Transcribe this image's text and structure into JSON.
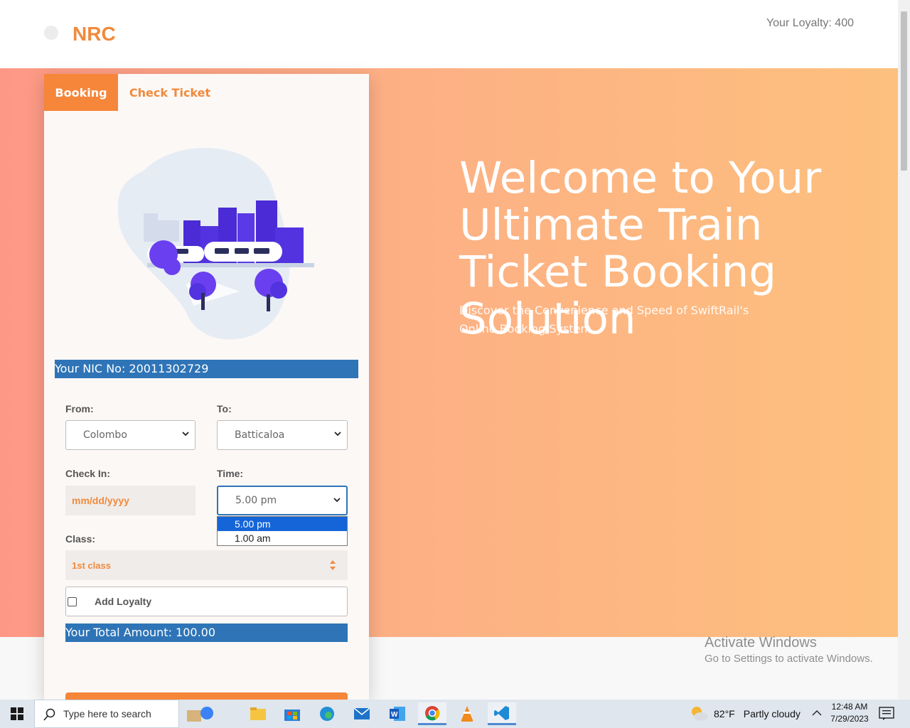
{
  "header": {
    "brand": "NRC",
    "loyalty_text": "Your Loyalty: 400"
  },
  "hero": {
    "title": "Welcome to Your Ultimate Train Ticket Booking Solution",
    "subtitle": "Discover the Convenience and Speed of SwiftRail's Online Booking System"
  },
  "card": {
    "tabs": [
      {
        "label": "Booking",
        "active": true
      },
      {
        "label": "Check Ticket",
        "active": false
      }
    ],
    "nic_text": "Your NIC No: 20011302729",
    "from": {
      "label": "From:",
      "value": "Colombo"
    },
    "to": {
      "label": "To:",
      "value": "Batticaloa"
    },
    "check_in": {
      "label": "Check In:",
      "placeholder": "mm/dd/yyyy"
    },
    "time": {
      "label": "Time:",
      "value": "5.00 pm",
      "options": [
        "5.00 pm",
        "1.00 am"
      ],
      "open": true
    },
    "class": {
      "label": "Class:",
      "value": "1st class"
    },
    "add_loyalty": {
      "label": "Add Loyalty",
      "checked": false
    },
    "total_text": "Your Total Amount: 100.00"
  },
  "watermark": {
    "line1": "Activate Windows",
    "line2": "Go to Settings to activate Windows."
  },
  "taskbar": {
    "search_placeholder": "Type here to search",
    "weather_temp": "82°F",
    "weather_desc": "Partly cloudy",
    "time": "12:48 AM",
    "date": "7/29/2023",
    "apps": [
      "file-explorer",
      "microsoft-store",
      "edge",
      "mail",
      "word",
      "chrome",
      "vlc",
      "vscode"
    ]
  },
  "colors": {
    "accent": "#f5863a",
    "info_bar": "#2e74b7",
    "select_highlight": "#1565d8"
  }
}
